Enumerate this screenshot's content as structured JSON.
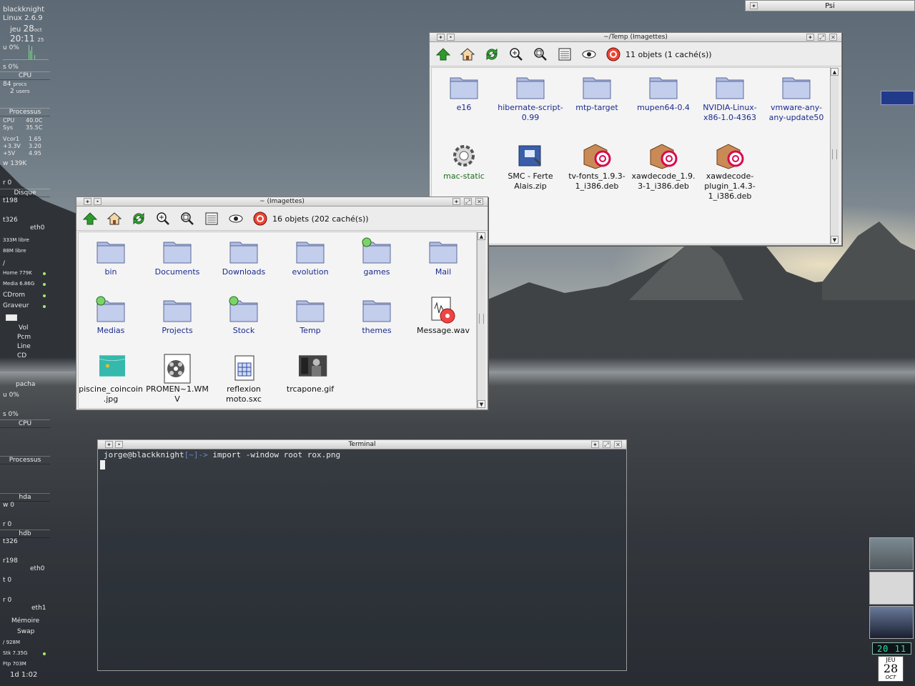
{
  "sysmon": {
    "host": "blackknight",
    "kernel": "Linux 2.6.9",
    "date_day": "jeu",
    "date_num": "28",
    "date_month": "oct",
    "time": "20:11",
    "seconds": "25",
    "u_pct": "u 0%",
    "s_pct": "s 0%",
    "cpu_label": "CPU",
    "procs": "84",
    "procs_lbl": "procs",
    "users": "2",
    "users_lbl": "users",
    "proc_header": "Processus",
    "cpu_temp_lbl": "CPU",
    "cpu_temp": "40.0C",
    "sys_temp_lbl": "Sys",
    "sys_temp": "35.5C",
    "vcor_lbl": "Vcor1",
    "vcor": "1.65",
    "v33_lbl": "+3.3V",
    "v33": "3.20",
    "v5_lbl": "+5V",
    "v5": "4.95",
    "net_w": "w 139K",
    "net_r": "r 0",
    "disk_header": "Disque",
    "disk_t198": "t198",
    "disk_t326": "t326",
    "eth0": "eth0",
    "mem_free1": "333M libre",
    "mem_free2": "88M libre",
    "fs_root": "/",
    "fs_home": "Home 779K",
    "fs_media": "Media 6.86G",
    "cdrom": "CDrom",
    "graveur": "Graveur",
    "vol": "Vol",
    "pcm": "Pcm",
    "line": "Line",
    "cd": "CD",
    "user2": "pacha",
    "u2_pct": "u 0%",
    "s2_pct": "s 0%",
    "cpu2": "CPU",
    "proc2": "Processus",
    "hda": "hda",
    "w0": "w 0",
    "r0": "r 0",
    "hdb": "hdb",
    "t326b": "t326",
    "r198": "r198",
    "eth0b": "eth0",
    "t0": "t 0",
    "r0b": "r 0",
    "eth1": "eth1",
    "memoire": "Mémoire",
    "swap": "Swap",
    "fs928": "/ 928M",
    "stk": "Stk 7.35G",
    "ftp": "Ftp 703M",
    "uptime": "1d  1:02"
  },
  "psi": {
    "title": "Psi"
  },
  "win_temp": {
    "title": "~/Temp (Imagettes)",
    "status": "11 objets (1 caché(s))",
    "items": [
      {
        "label": "e16",
        "kind": "folder"
      },
      {
        "label": "hibernate-script-0.99",
        "kind": "folder"
      },
      {
        "label": "mtp-target",
        "kind": "folder"
      },
      {
        "label": "mupen64-0.4",
        "kind": "folder"
      },
      {
        "label": "NVIDIA-Linux-x86-1.0-4363",
        "kind": "folder"
      },
      {
        "label": "vmware-any-any-update50",
        "kind": "folder"
      },
      {
        "label": "mac-static",
        "kind": "exec"
      },
      {
        "label": "SMC - Ferte Alais.zip",
        "kind": "zip"
      },
      {
        "label": "tv-fonts_1.9.3-1_i386.deb",
        "kind": "deb"
      },
      {
        "label": "xawdecode_1.9.3-1_i386.deb",
        "kind": "deb"
      },
      {
        "label": "xawdecode-plugin_1.4.3-1_i386.deb",
        "kind": "deb"
      }
    ]
  },
  "win_home": {
    "title": "~ (Imagettes)",
    "status": "16 objets (202 caché(s))",
    "items": [
      {
        "label": "bin",
        "kind": "folder"
      },
      {
        "label": "Documents",
        "kind": "folder"
      },
      {
        "label": "Downloads",
        "kind": "folder"
      },
      {
        "label": "evolution",
        "kind": "folder"
      },
      {
        "label": "games",
        "kind": "mount"
      },
      {
        "label": "Mail",
        "kind": "folder"
      },
      {
        "label": "Medias",
        "kind": "mount"
      },
      {
        "label": "Projects",
        "kind": "folder"
      },
      {
        "label": "Stock",
        "kind": "mount"
      },
      {
        "label": "Temp",
        "kind": "folder"
      },
      {
        "label": "themes",
        "kind": "folder"
      },
      {
        "label": "Message.wav",
        "kind": "audio"
      },
      {
        "label": "piscine_coincoin.jpg",
        "kind": "image"
      },
      {
        "label": "PROMEN~1.WMV",
        "kind": "video"
      },
      {
        "label": "reflexion moto.sxc",
        "kind": "sheet"
      },
      {
        "label": "trcapone.gif",
        "kind": "photo"
      }
    ]
  },
  "terminal": {
    "title": "Terminal",
    "user_host": "jorge@blackknight",
    "path": "[~]",
    "arrow": "->",
    "command": "import -window root rox.png"
  },
  "clock": {
    "time": "20 11",
    "cal_day": "JEU",
    "cal_num": "28",
    "cal_month": "OCT"
  },
  "colors": {
    "link": "#1a2a8f",
    "exec": "#1d6b1d",
    "folder": "#a9b6da"
  }
}
